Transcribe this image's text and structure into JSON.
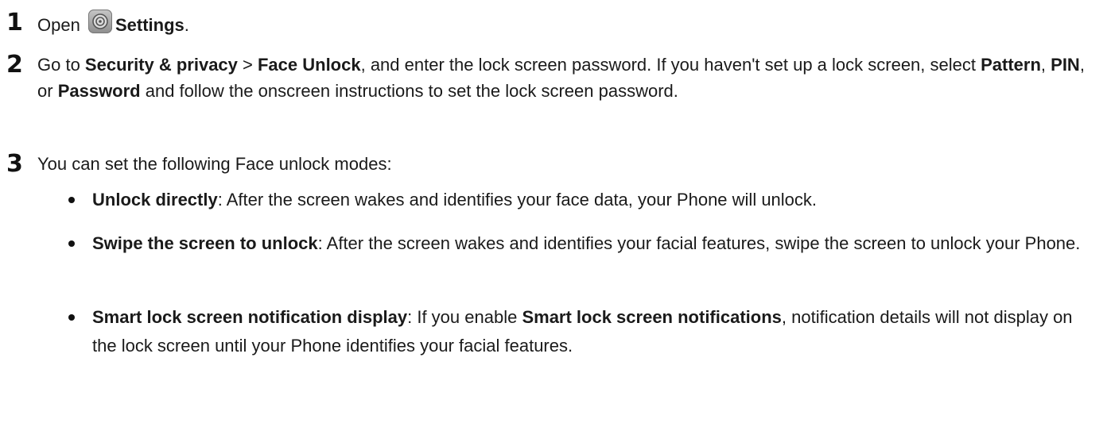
{
  "steps": [
    {
      "number": "1",
      "parts": [
        "Open",
        "Settings",
        "."
      ]
    },
    {
      "number": "2",
      "parts": [
        "Go to ",
        "Security & privacy",
        " > ",
        "Face Unlock",
        ", and enter the lock screen password. If you haven't set up a lock screen, select ",
        "Pattern",
        ", ",
        "PIN",
        ", or ",
        "Password",
        " and follow the onscreen instructions to set the lock screen password."
      ]
    },
    {
      "number": "3",
      "text": "You can set the following Face unlock modes:",
      "modes": [
        {
          "title": "Unlock directly",
          "desc": ": After the screen wakes and identifies your face data, your Phone will unlock."
        },
        {
          "title": "Swipe the screen to unlock",
          "desc": ": After the screen wakes and identifies your facial features, swipe the screen to unlock your Phone."
        },
        {
          "title": "Smart lock screen notification display",
          "desc_before": ": If you enable ",
          "highlight": "Smart lock screen notifications",
          "desc_after": ", notification details will not display on the lock screen until your Phone identifies your facial features."
        }
      ]
    }
  ],
  "icons": {
    "settings": "settings-gear-icon"
  }
}
